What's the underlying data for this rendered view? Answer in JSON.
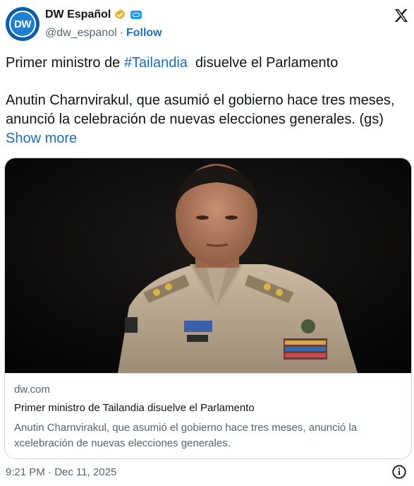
{
  "author": {
    "display_name": "DW Español",
    "handle": "@dw_espanol",
    "separator": "·",
    "follow_label": "Follow",
    "avatar_text": "DW"
  },
  "tweet": {
    "text_before": "Primer ministro de ",
    "hashtag": "#Tailandia",
    "text_after": "  disuelve el Parlamento",
    "body": "Anutin Charnvirakul, que asumió el gobierno hace tres meses, anunció la celebración de nuevas elecciones generales. (gs) ",
    "show_more": "Show more"
  },
  "card": {
    "domain": "dw.com",
    "title": "Primer ministro de Tailandia disuelve el Parlamento",
    "description": "Anutin Charnvirakul, que asumió el gobierno hace tres meses, anunció la xcelebración de nuevas elecciones generales."
  },
  "footer": {
    "timestamp": "9:21 PM · Dec 11, 2025"
  },
  "colors": {
    "link": "#1d70b8",
    "secondary_text": "#536471",
    "border": "#cfd9de",
    "verified_gold": "#e8b32a",
    "dw_blue": "#0a5ea8"
  },
  "icons": [
    "verified-badge-icon",
    "affiliate-badge-icon",
    "x-logo-icon",
    "info-icon"
  ]
}
